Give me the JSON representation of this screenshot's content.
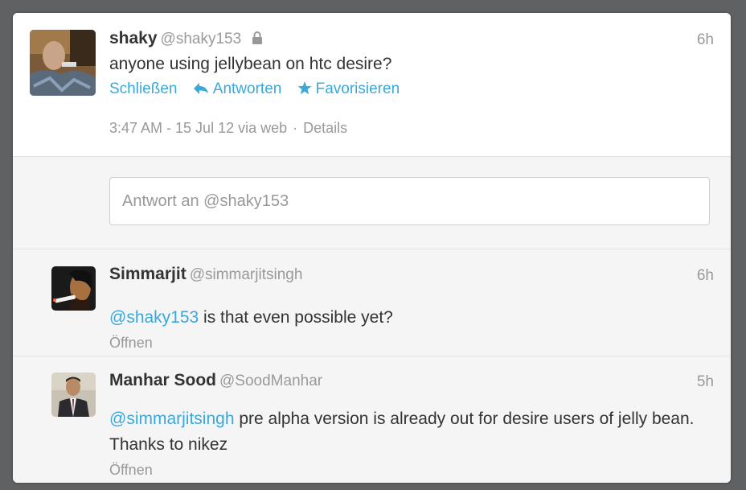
{
  "main_tweet": {
    "name": "shaky",
    "handle": "@shaky153",
    "time": "6h",
    "text": "anyone using jellybean on htc desire?",
    "actions": {
      "close": "Schließen",
      "reply": "Antworten",
      "favorite": "Favorisieren"
    },
    "meta": {
      "timestamp": "3:47 AM - 15 Jul 12 via web",
      "separator": "·",
      "details": "Details"
    }
  },
  "reply_box": {
    "placeholder": "Antwort an @shaky153"
  },
  "replies": [
    {
      "name": "Simmarjit",
      "handle": "@simmarjitsingh",
      "time": "6h",
      "mention": "@shaky153",
      "text": " is that even possible yet?",
      "open": "Öffnen"
    },
    {
      "name": "Manhar Sood",
      "handle": "@SoodManhar",
      "time": "5h",
      "mention": "@simmarjitsingh",
      "text": " pre alpha version is already out for desire users of jelly bean. Thanks to nikez",
      "open": "Öffnen"
    }
  ],
  "colors": {
    "link": "#3aa8d8",
    "muted": "#999999",
    "text": "#333333",
    "backdrop": "#5f6163"
  },
  "icons": {
    "protected": "lock-icon",
    "reply": "reply-arrow-icon",
    "favorite": "star-icon"
  }
}
